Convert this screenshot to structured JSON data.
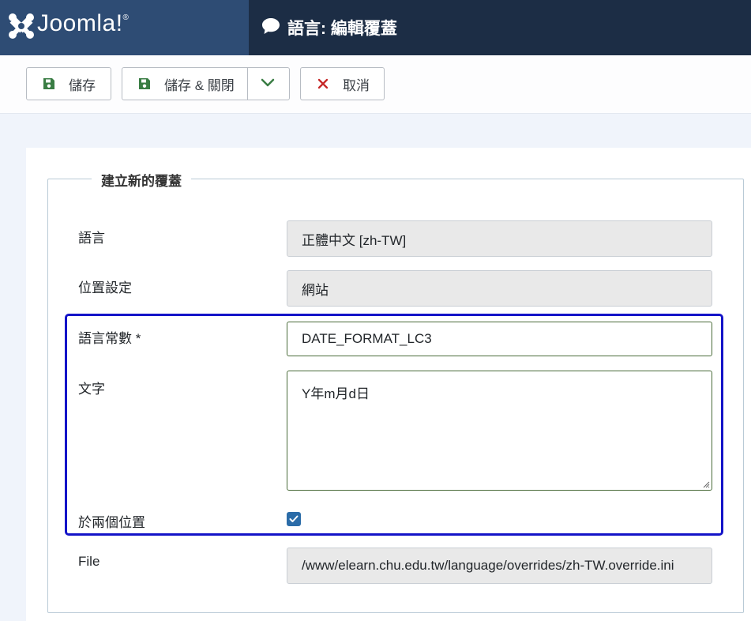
{
  "header": {
    "logo_text": "Joomla!",
    "logo_mark": "®",
    "title": "語言: 編輯覆蓋",
    "title_icon": "comment-icon",
    "bg_color": "#1c2d45",
    "logo_bg_color": "#2e4c74"
  },
  "toolbar": {
    "save_label": "儲存",
    "save_close_label": "儲存 & 關閉",
    "cancel_label": "取消",
    "save_icon_color": "#3a7d44",
    "cancel_icon_color": "#c62828"
  },
  "form": {
    "legend": "建立新的覆蓋",
    "language_label": "語言",
    "language_value": "正體中文 [zh-TW]",
    "location_label": "位置設定",
    "location_value": "網站",
    "constant_label": "語言常數 *",
    "constant_value": "DATE_FORMAT_LC3",
    "text_label": "文字",
    "text_value": "Y年m月d日",
    "both_label": "於兩個位置",
    "both_checked": true,
    "file_label": "File",
    "file_value": "/www/elearn.chu.edu.tw/language/overrides/zh-TW.override.ini"
  }
}
